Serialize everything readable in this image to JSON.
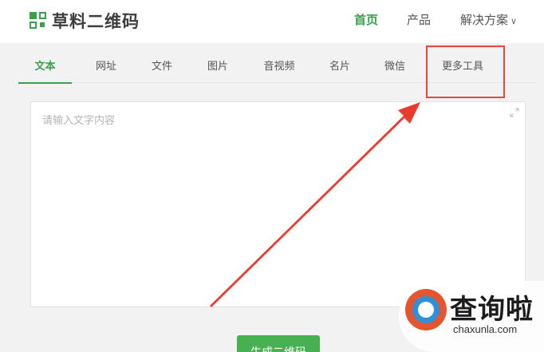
{
  "header": {
    "logo_text": "草料二维码",
    "nav": {
      "home": "首页",
      "products": "产品",
      "solutions": "解决方案"
    }
  },
  "tabs": {
    "text": "文本",
    "url": "网址",
    "file": "文件",
    "image": "图片",
    "media": "音视频",
    "card": "名片",
    "wechat": "微信",
    "more": "更多工具"
  },
  "editor": {
    "placeholder": "请输入文字内容",
    "value": ""
  },
  "generate_button": "生成二维码",
  "watermark": {
    "title": "查询啦",
    "domain": "chaxunla.com"
  },
  "colors": {
    "brand_green": "#3aa14a",
    "highlight_red": "#e8473f",
    "button_green": "#46b052"
  }
}
